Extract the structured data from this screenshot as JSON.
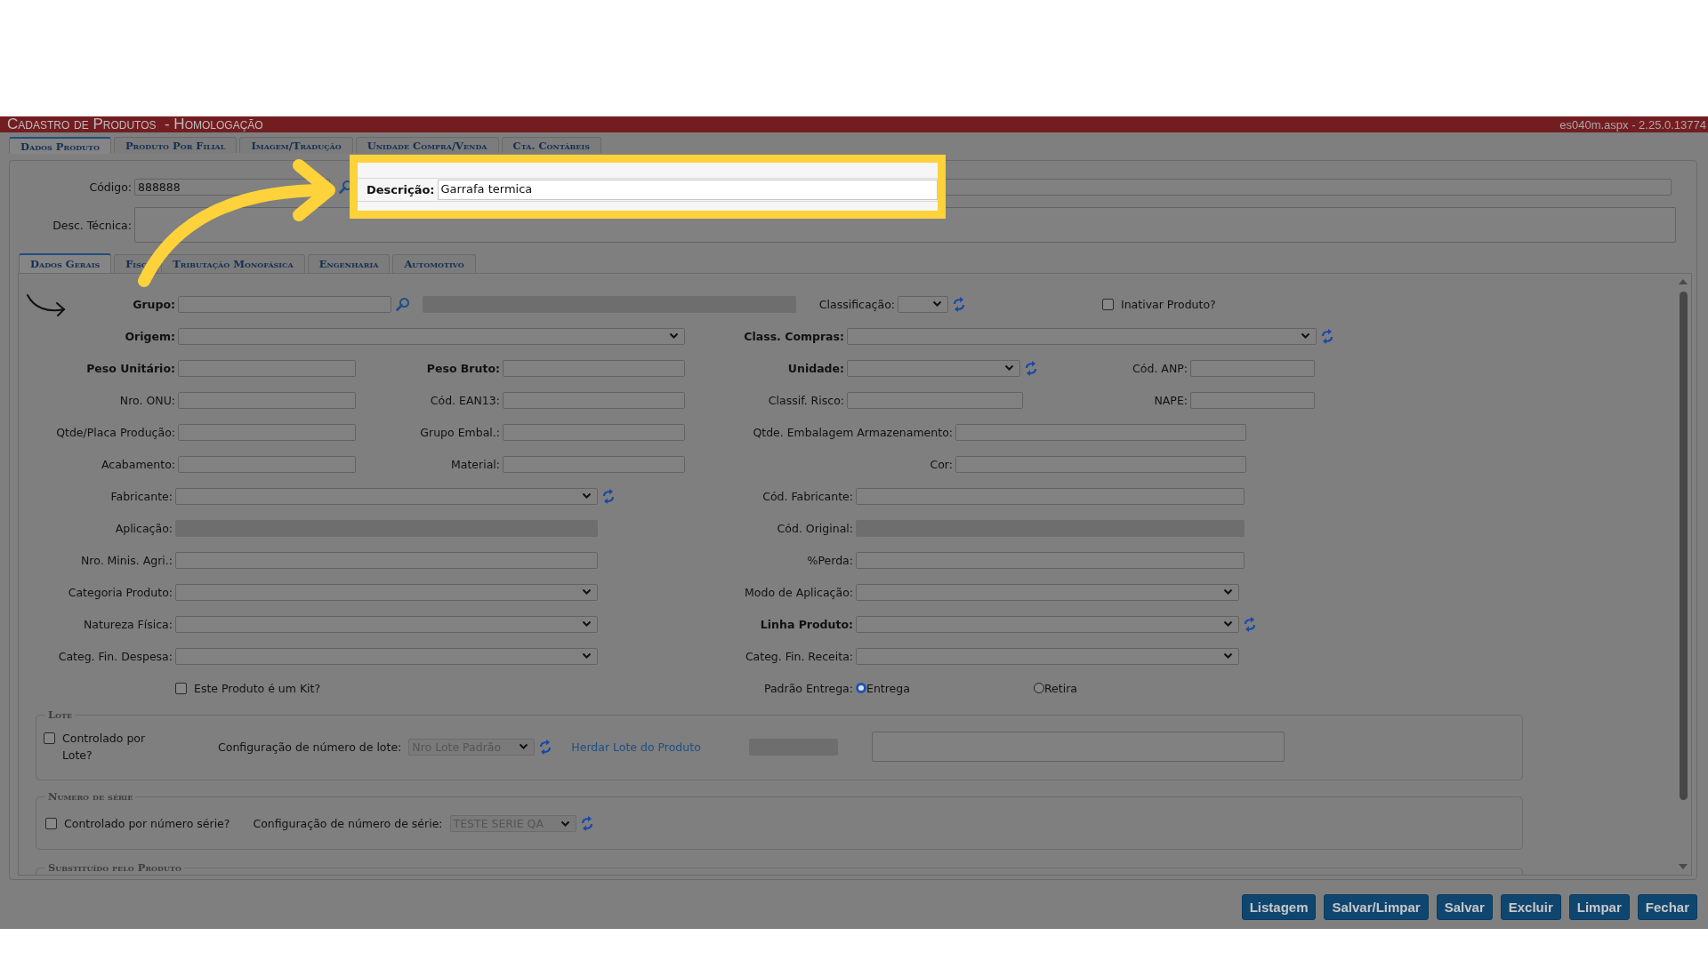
{
  "title_bar": {
    "title": "Cadastro de Produtos  - Homologação",
    "version": "es040m.aspx - 2.25.0.13774"
  },
  "tabs": [
    {
      "label": "Dados Produto",
      "selected": true
    },
    {
      "label": "Produto Por Filial",
      "selected": false
    },
    {
      "label": "Imagem/Tradução",
      "selected": false
    },
    {
      "label": "Unidade Compra/Venda",
      "selected": false
    },
    {
      "label": "Cta. Contábeis",
      "selected": false
    }
  ],
  "header": {
    "codigo": {
      "label": "Código:",
      "value": "888888"
    },
    "descricao": {
      "label": "Descrição:",
      "value": "Garrafa termica"
    },
    "desc_tecnica": {
      "label": "Desc. Técnica:"
    }
  },
  "sub_tabs": [
    {
      "label": "Dados Gerais",
      "selected": true
    },
    {
      "label": "Fisc",
      "selected": false
    },
    {
      "label": "Tributação Monofásica",
      "selected": false
    },
    {
      "label": "Engenharia",
      "selected": false
    },
    {
      "label": "Automotivo",
      "selected": false
    }
  ],
  "form_rows": [
    {
      "cells": [
        {
          "kind": "text",
          "label": "Grupo:",
          "bold": true
        },
        {
          "kind": "readonly"
        },
        {
          "kind": "select",
          "label": "Classificação:",
          "bold": false
        },
        {
          "kind": "checkbox",
          "label": "Inativar Produto?",
          "checked": false
        }
      ]
    },
    {
      "cells": [
        {
          "kind": "select",
          "label": "Origem:",
          "bold": true
        },
        {
          "kind": "select",
          "label": "Class. Compras:",
          "bold": true
        }
      ]
    },
    {
      "cells": [
        {
          "kind": "text",
          "label": "Peso Unitário:",
          "bold": true
        },
        {
          "kind": "text",
          "label": "Peso Bruto:",
          "bold": true
        },
        {
          "kind": "select",
          "label": "Unidade:",
          "bold": true
        },
        {
          "kind": "text",
          "label": "Cód. ANP:",
          "bold": false
        }
      ]
    },
    {
      "cells": [
        {
          "kind": "text",
          "label": "Nro. ONU:",
          "bold": false
        },
        {
          "kind": "text",
          "label": "Cód. EAN13:",
          "bold": false
        },
        {
          "kind": "text",
          "label": "Classif. Risco:",
          "bold": false
        },
        {
          "kind": "text",
          "label": "NAPE:",
          "bold": false
        }
      ]
    },
    {
      "cells": [
        {
          "kind": "text",
          "label": "Qtde/Placa Produção:",
          "bold": false
        },
        {
          "kind": "text",
          "label": "Grupo Embal.:",
          "bold": false
        },
        {
          "kind": "text",
          "label": "Qtde. Embalagem Armazenamento:",
          "bold": false
        }
      ]
    },
    {
      "cells": [
        {
          "kind": "text",
          "label": "Acabamento:",
          "bold": false
        },
        {
          "kind": "text",
          "label": "Material:",
          "bold": false
        },
        {
          "kind": "text",
          "label": "Cor:",
          "bold": false
        }
      ]
    },
    {
      "cells": [
        {
          "kind": "select",
          "label": "Fabricante:",
          "bold": false
        },
        {
          "kind": "text",
          "label": "Cód. Fabricante:",
          "bold": false
        }
      ]
    },
    {
      "cells": [
        {
          "kind": "readonly",
          "label": "Aplicação:",
          "bold": false
        },
        {
          "kind": "readonly",
          "label": "Cód. Original:",
          "bold": false
        }
      ]
    },
    {
      "cells": [
        {
          "kind": "text",
          "label": "Nro. Minis. Agri.:",
          "bold": false
        },
        {
          "kind": "text",
          "label": "%Perda:",
          "bold": false
        }
      ]
    },
    {
      "cells": [
        {
          "kind": "select",
          "label": "Categoria Produto:",
          "bold": false
        },
        {
          "kind": "select",
          "label": "Modo de Aplicação:",
          "bold": false
        }
      ]
    },
    {
      "cells": [
        {
          "kind": "select",
          "label": "Natureza Física:",
          "bold": false
        },
        {
          "kind": "select",
          "label": "Linha Produto:",
          "bold": true
        }
      ]
    },
    {
      "cells": [
        {
          "kind": "select",
          "label": "Categ. Fin. Despesa:",
          "bold": false
        },
        {
          "kind": "select",
          "label": "Categ. Fin. Receita:",
          "bold": false
        }
      ]
    },
    {
      "cells": [
        {
          "kind": "checkbox",
          "label": "Este Produto é um Kit?",
          "checked": false
        },
        {
          "kind": "radio_group",
          "label": "Padrão Entrega:",
          "bold": false,
          "options": [
            {
              "label": "Entrega",
              "selected": true
            },
            {
              "label": "Retira",
              "selected": false
            }
          ]
        }
      ]
    }
  ],
  "lote": {
    "legend": "Lote",
    "checkbox": {
      "label": "Controlado por Lote?",
      "checked": false
    },
    "config_label": "Configuração de número de lote:",
    "config_value": "Nro Lote Padrão",
    "link": "Herdar Lote do Produto"
  },
  "numero_serie": {
    "legend": "Numero de série",
    "checkbox": {
      "label": "Controlado por número série?",
      "checked": false
    },
    "config_label": "Configuração de número de série:",
    "config_value": "TESTE SERIE QA"
  },
  "substituido": {
    "legend": "Substituído pelo Produto"
  },
  "buttons": [
    "Listagem",
    "Salvar/Limpar",
    "Salvar",
    "Excluir",
    "Limpar",
    "Fechar"
  ]
}
